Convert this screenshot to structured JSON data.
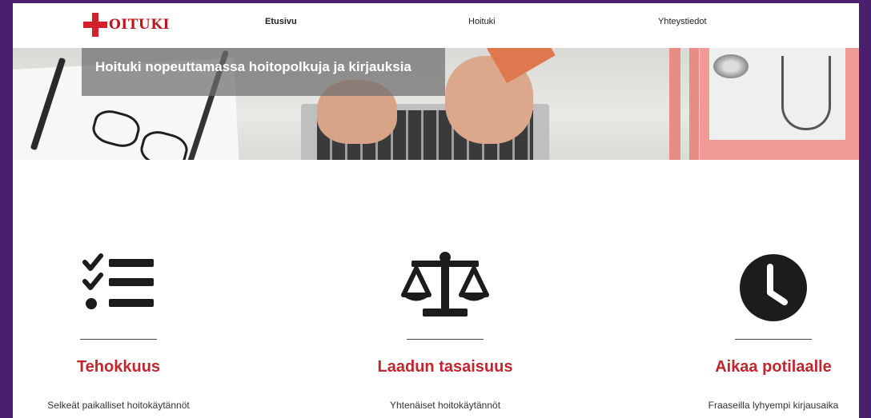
{
  "logo": {
    "text": "OITUKI",
    "accent_color": "#d3202b"
  },
  "nav": [
    {
      "label": "Etusivu",
      "active": true
    },
    {
      "label": "Hoituki",
      "active": false
    },
    {
      "label": "Yhteystiedot",
      "active": false
    }
  ],
  "hero": {
    "title": "Hoituki nopeuttamassa hoitopolkuja ja kirjauksia"
  },
  "features": [
    {
      "icon": "checklist-icon",
      "title": "Tehokkuus",
      "desc": "Selkeät paikalliset hoitokäytännöt"
    },
    {
      "icon": "scales-icon",
      "title": "Laadun tasaisuus",
      "desc": "Yhtenäiset hoitokäytännöt"
    },
    {
      "icon": "clock-icon",
      "title": "Aikaa potilaalle",
      "desc": "Fraaseilla lyhyempi kirjausaika"
    }
  ],
  "colors": {
    "frame": "#4a1f6e",
    "feature_title": "#c0262d"
  }
}
